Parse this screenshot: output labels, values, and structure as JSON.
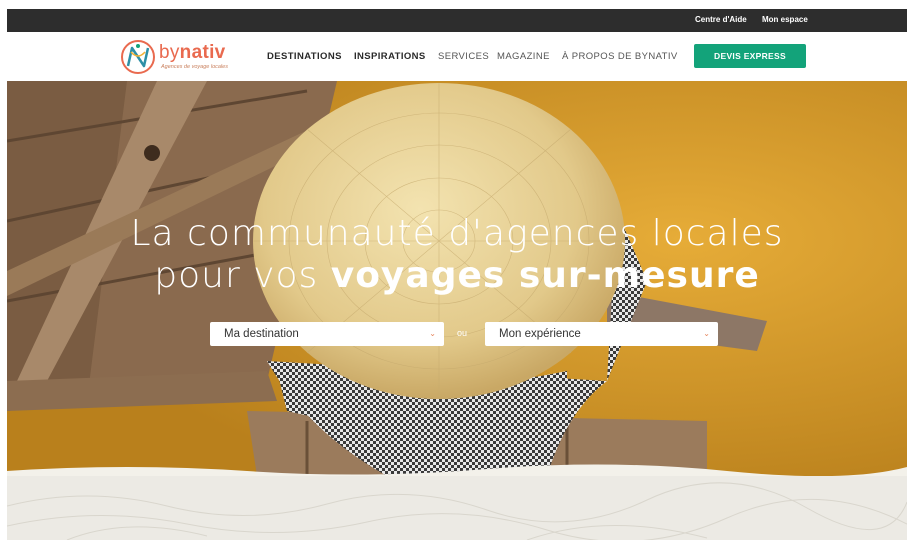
{
  "topbar": {
    "help_link": "Centre d'Aide",
    "account_link": "Mon espace"
  },
  "logo": {
    "prefix": "by",
    "brand": "nativ",
    "tagline": "Agences de voyage locales"
  },
  "nav": {
    "items": [
      {
        "label": "DESTINATIONS"
      },
      {
        "label": "INSPIRATIONS"
      },
      {
        "label": "SERVICES"
      },
      {
        "label": "MAGAZINE"
      },
      {
        "label": "À PROPOS DE BYNATIV"
      }
    ],
    "cta_label": "DEVIS EXPRESS"
  },
  "hero": {
    "headline_line1": "La communauté d'agences locales",
    "headline_line2_plain": "pour vos",
    "headline_line2_bold": "voyages sur-mesure",
    "destination_select": "Ma destination",
    "separator": "ou",
    "experience_select": "Mon expérience"
  },
  "colors": {
    "topbar": "#2d2d2d",
    "brand_orange": "#e96a4f",
    "cta_green": "#13a37a",
    "hero_water": "#d59a2b"
  }
}
